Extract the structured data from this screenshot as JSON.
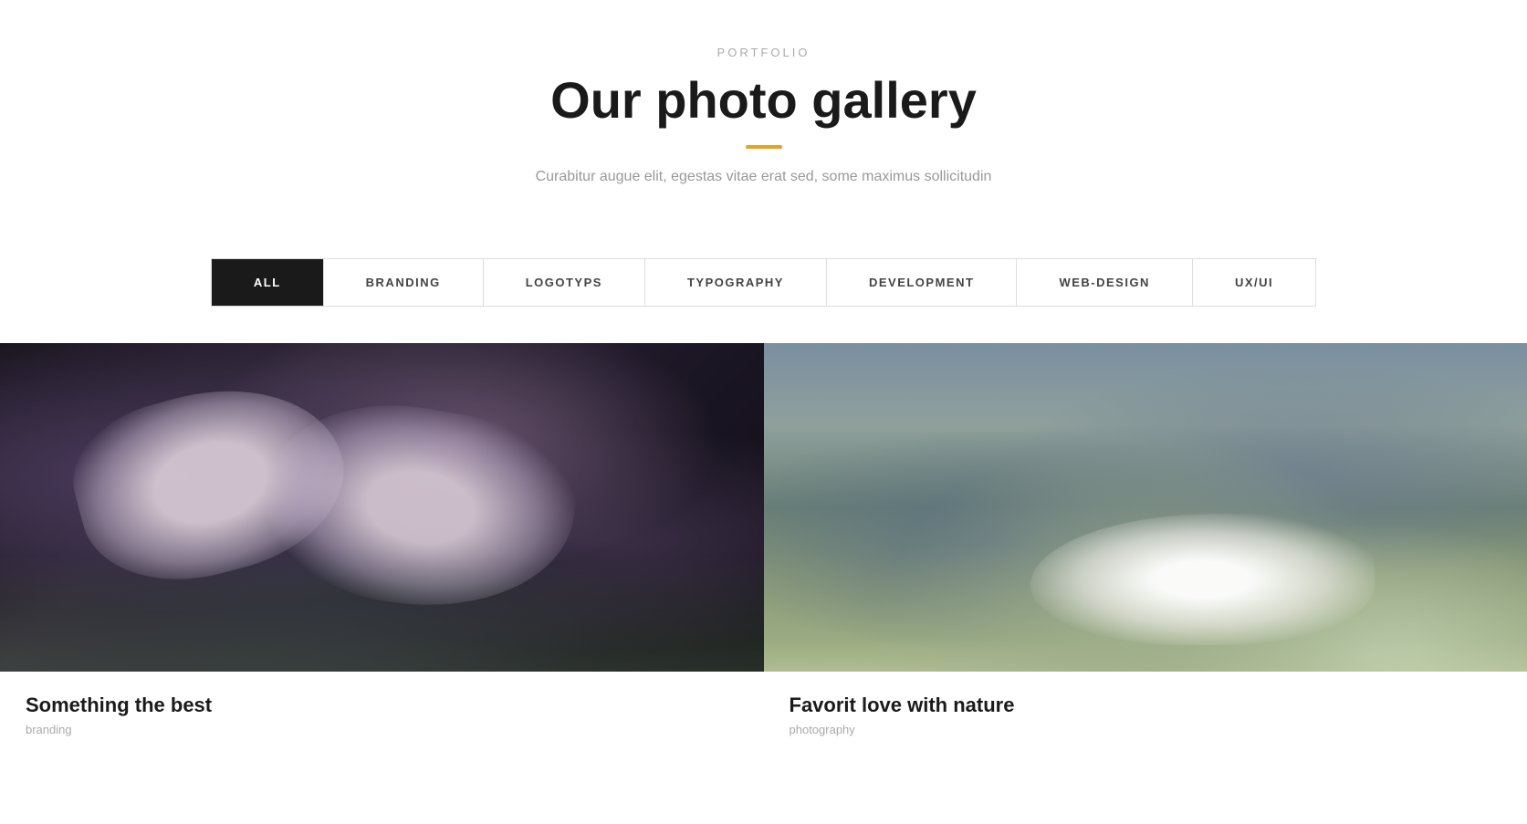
{
  "header": {
    "portfolio_label": "PORTFOLIO",
    "main_title": "Our photo gallery",
    "divider_color": "#e8a020",
    "subtitle": "Curabitur augue elit, egestas vitae erat sed, some maximus sollicitudin"
  },
  "filter_tabs": [
    {
      "id": "all",
      "label": "ALL",
      "active": true
    },
    {
      "id": "branding",
      "label": "BRANDING",
      "active": false
    },
    {
      "id": "logotyps",
      "label": "LOGOTYPS",
      "active": false
    },
    {
      "id": "typography",
      "label": "TYPOGRAPHY",
      "active": false
    },
    {
      "id": "development",
      "label": "DEVELOPMENT",
      "active": false
    },
    {
      "id": "web-design",
      "label": "WEB-DESIGN",
      "active": false
    },
    {
      "id": "ux-ui",
      "label": "UX/UI",
      "active": false
    }
  ],
  "gallery_items": [
    {
      "id": "item1",
      "title": "Something the best",
      "category": "branding",
      "image_type": "left"
    },
    {
      "id": "item2",
      "title": "Favorit love with nature",
      "category": "photography",
      "image_type": "right"
    }
  ]
}
